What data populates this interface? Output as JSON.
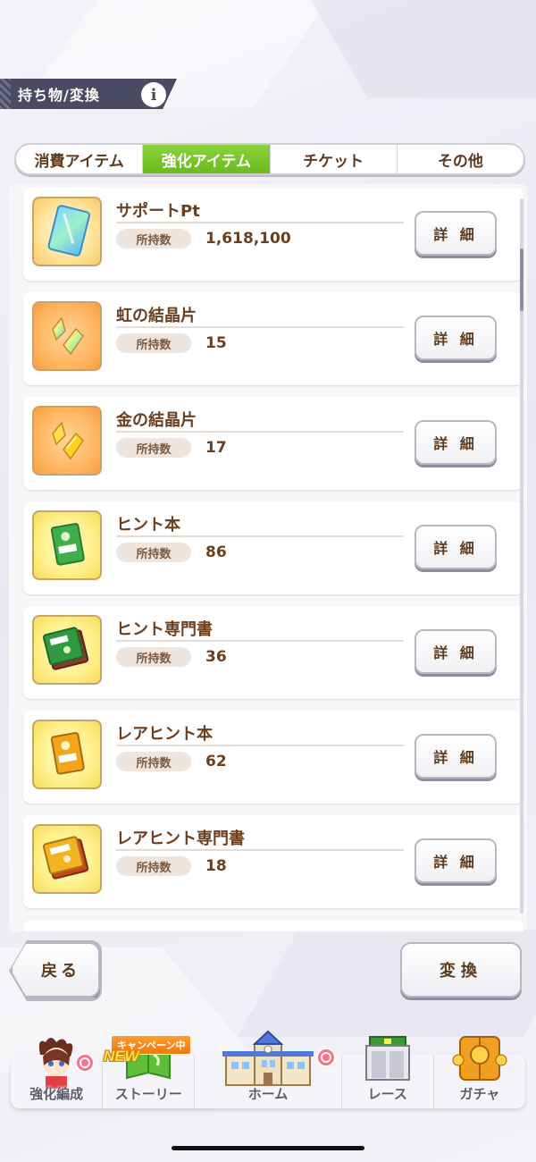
{
  "header": {
    "title": "持ち物/変換",
    "info_symbol": "i"
  },
  "tabs": [
    {
      "label": "消費アイテム",
      "active": false
    },
    {
      "label": "強化アイテム",
      "active": true
    },
    {
      "label": "チケット",
      "active": false
    },
    {
      "label": "その他",
      "active": false
    }
  ],
  "items": [
    {
      "name": "サポートPt",
      "count_label": "所持数",
      "count": "1,618,100",
      "detail_label": "詳 細",
      "icon": "support-pt-card-icon"
    },
    {
      "name": "虹の結晶片",
      "count_label": "所持数",
      "count": "15",
      "detail_label": "詳 細",
      "icon": "rainbow-crystal-icon"
    },
    {
      "name": "金の結晶片",
      "count_label": "所持数",
      "count": "17",
      "detail_label": "詳 細",
      "icon": "gold-crystal-icon"
    },
    {
      "name": "ヒント本",
      "count_label": "所持数",
      "count": "86",
      "detail_label": "詳 細",
      "icon": "hint-book-icon"
    },
    {
      "name": "ヒント専門書",
      "count_label": "所持数",
      "count": "36",
      "detail_label": "詳 細",
      "icon": "hint-technical-book-icon"
    },
    {
      "name": "レアヒント本",
      "count_label": "所持数",
      "count": "62",
      "detail_label": "詳 細",
      "icon": "rare-hint-book-icon"
    },
    {
      "name": "レアヒント専門書",
      "count_label": "所持数",
      "count": "18",
      "detail_label": "詳 細",
      "icon": "rare-hint-technical-book-icon"
    }
  ],
  "buttons": {
    "back": "戻る",
    "convert": "変換"
  },
  "nav": {
    "items": [
      {
        "label": "強化編成"
      },
      {
        "label": "ストーリー"
      },
      {
        "label": "ホーム"
      },
      {
        "label": "レース"
      },
      {
        "label": "ガチャ"
      }
    ],
    "campaign_tag": "キャンペーン中",
    "new_tag": "NEW"
  },
  "colors": {
    "accent_green": "#7cc72c",
    "text_brown": "#6b3e1e",
    "header_bg": "#4a4a62"
  }
}
